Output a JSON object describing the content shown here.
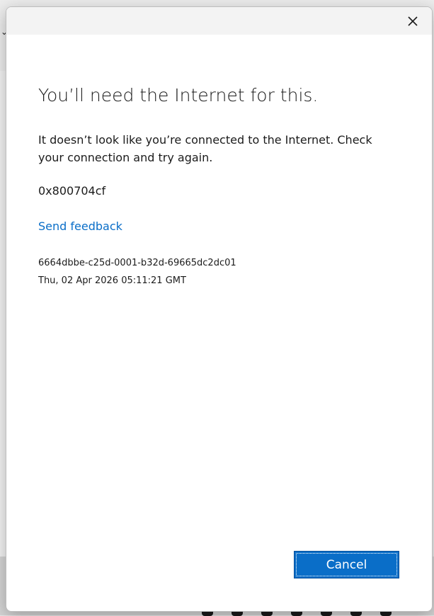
{
  "dialog": {
    "heading": "You’ll need the Internet for this.",
    "message": "It doesn’t look like you’re connected to the Internet. Check your connection and try again.",
    "error_code": "0x800704cf",
    "feedback_link": "Send feedback",
    "correlation_id": "6664dbbe-c25d-0001-b32d-69665dc2dc01",
    "timestamp": "Thu, 02 Apr 2026 05:11:21 GMT",
    "cancel_label": "Cancel",
    "close_icon": "close-icon"
  },
  "colors": {
    "accent": "#0a6ec8",
    "link": "#0a6ec8",
    "titlebar": "#f3f3f3",
    "text": "#1b1b1b"
  }
}
